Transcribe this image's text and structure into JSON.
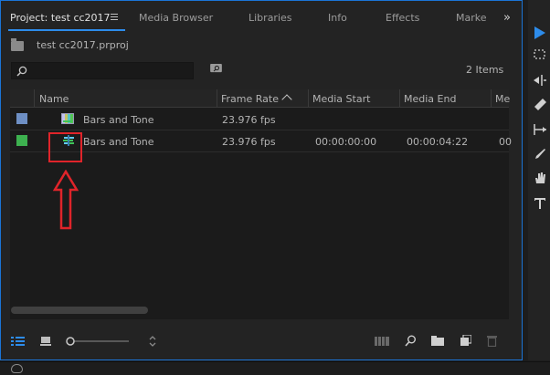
{
  "tabs": [
    {
      "label": "Project: test cc2017",
      "active": true
    },
    {
      "label": "Media Browser"
    },
    {
      "label": "Libraries"
    },
    {
      "label": "Info"
    },
    {
      "label": "Effects"
    },
    {
      "label": "Marke"
    }
  ],
  "overflow_glyph": "»",
  "project": {
    "file_name": "test cc2017.prproj",
    "items_count": "2 Items"
  },
  "search": {
    "placeholder": ""
  },
  "table": {
    "columns": [
      "Name",
      "Frame Rate",
      "Media Start",
      "Media End",
      "Me"
    ],
    "rows": [
      {
        "color": "#6e8fc4",
        "name": "Bars and Tone",
        "frame_rate": "23.976 fps",
        "media_start": "",
        "media_end": "",
        "extra": "",
        "icon": "clip-icon"
      },
      {
        "color": "#3db14f",
        "name": "Bars and Tone",
        "frame_rate": "23.976 fps",
        "media_start": "00:00:00:00",
        "media_end": "00:00:04:22",
        "extra": "00",
        "icon": "sequence-icon"
      }
    ]
  },
  "annotation": {
    "color": "#e0242a"
  },
  "colors": {
    "accent": "#2d8ceb",
    "panel_bg": "#232323",
    "list_bg": "#1b1b1b"
  },
  "tools": [
    "selection-tool-icon",
    "marquee-tool-icon",
    "ripple-edit-tool-icon",
    "razor-tool-icon",
    "slip-tool-icon",
    "pen-tool-icon",
    "hand-tool-icon",
    "type-tool-icon"
  ],
  "bottom_icons": [
    "list-view-icon",
    "icon-view-icon",
    "zoom-slider",
    "sort-icons-icon",
    "automate-to-sequence-icon",
    "find-icon",
    "new-bin-icon",
    "new-item-icon",
    "clear-icon"
  ]
}
